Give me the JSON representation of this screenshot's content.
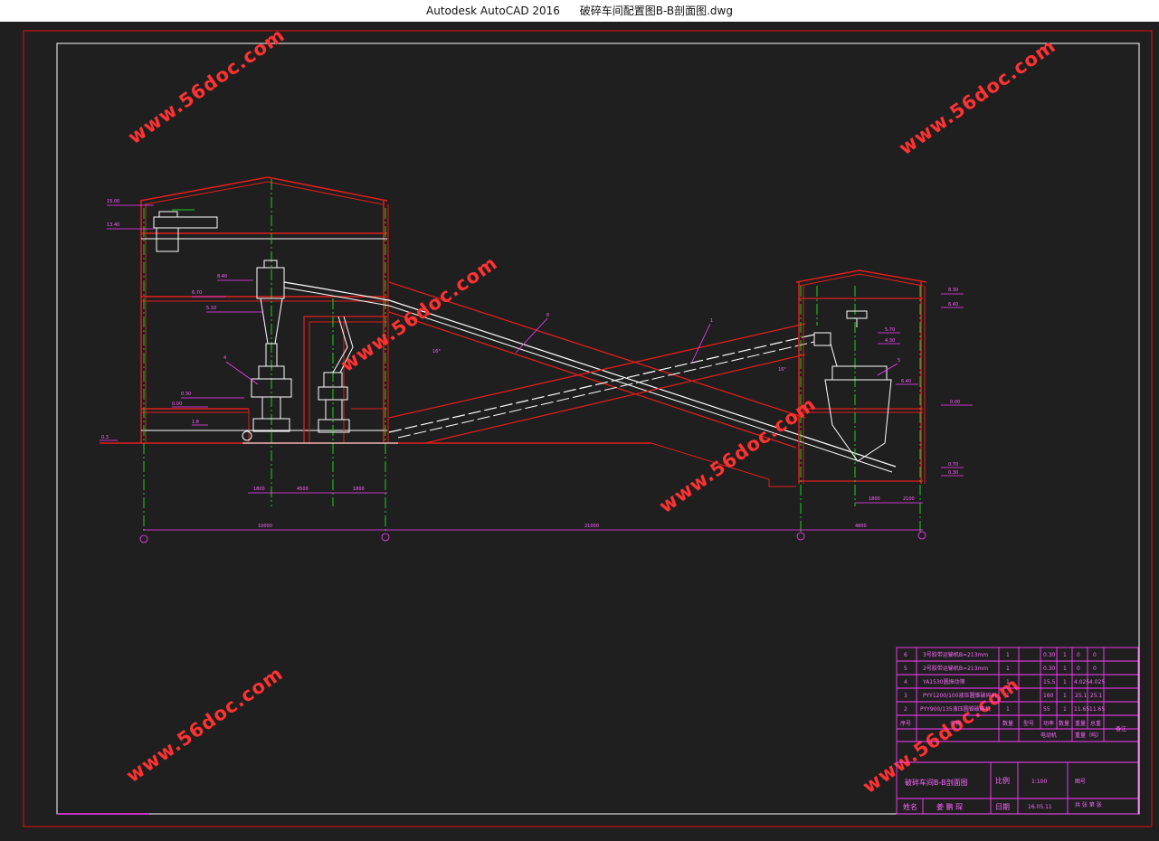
{
  "window": {
    "app_title": "Autodesk AutoCAD 2016",
    "file_title": "破碎车间配置图B-B剖面图.dwg"
  },
  "colors": {
    "background": "#1f1f1f",
    "frame_red": "#c81414",
    "structure_red": "#e01e1e",
    "equipment_white": "#ffffff",
    "annotation_magenta": "#ff3cff",
    "centerline_green": "#22cc22",
    "watermark": "#ff3232"
  },
  "watermarks": [
    "www.56doc.com",
    "www.56doc.com",
    "www.56doc.com",
    "www.56doc.com",
    "www.56doc.com",
    "www.56doc.com",
    "www.56doc.com"
  ],
  "elevations": {
    "left": [
      "15.00",
      "13.40",
      "8.40",
      "6.70",
      "5.10",
      "0.30",
      "0.00",
      "1.8",
      "0.3"
    ],
    "right": [
      "8.30",
      "6.40",
      "5.70",
      "4.30",
      "0.00",
      "6.40",
      "0.70",
      "0.30"
    ]
  },
  "dimensions": {
    "spans": [
      "10000",
      "21000",
      "4800"
    ],
    "left_sub": [
      "1800",
      "4500",
      "1800"
    ],
    "right_sub": [
      "1800",
      "2100"
    ],
    "angles": [
      "16°",
      "16°"
    ]
  },
  "callouts": [
    "4",
    "6",
    "1",
    "2",
    "2",
    "5"
  ],
  "title_block": {
    "rows": [
      {
        "no": "6",
        "name": "3号胶带运输机B=213mm",
        "qty": "1",
        "mat": "",
        "weight": "0.30",
        "w2": "1",
        "w3": "0",
        "w4": "0"
      },
      {
        "no": "5",
        "name": "2号胶带运输机B=213mm",
        "qty": "1",
        "mat": "",
        "weight": "0.30",
        "w2": "1",
        "w3": "0",
        "w4": "0"
      },
      {
        "no": "4",
        "name": "YA1530圆振动筛",
        "qty": "1",
        "mat": "",
        "weight": "15.5",
        "w2": "1",
        "w3": "4.025",
        "w4": "4.025"
      },
      {
        "no": "3",
        "name": "PYY1200/100液压圆锥破碎机",
        "qty": "1",
        "mat": "",
        "weight": "160",
        "w2": "1",
        "w3": "25.1",
        "w4": "25.1"
      },
      {
        "no": "2",
        "name": "PYY900/135液压圆锥破碎机",
        "qty": "1",
        "mat": "",
        "weight": "55",
        "w2": "1",
        "w3": "11.65",
        "w4": "11.65"
      }
    ],
    "header": {
      "no": "序号",
      "name": "名称",
      "qty": "数量",
      "type": "型号",
      "power": "功率",
      "count": "数量",
      "weight": "重量",
      "total": "总重",
      "remark": "备注"
    },
    "sub_header": {
      "motor": "电动机",
      "weight_t": "重量（吨）"
    },
    "drawing_name": "破碎车间B-B剖面图",
    "scale_label": "比例",
    "scale_value": "1:100",
    "drawing_no_label": "图号",
    "designer_label": "姓名",
    "designer": "姜 鹏 琛",
    "date_label": "日期",
    "date_value": "16.05.11",
    "sheet": "共 张 第 张"
  }
}
